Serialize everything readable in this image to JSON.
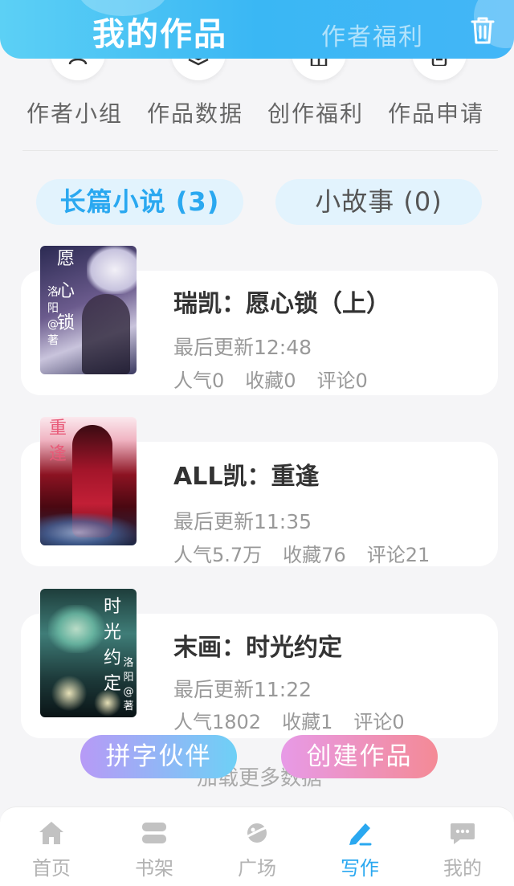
{
  "header": {
    "title": "我的作品",
    "link": "作者福利",
    "trash_icon": "trash-icon"
  },
  "menu": [
    {
      "label": "作者小组",
      "icon": "group-icon"
    },
    {
      "label": "作品数据",
      "icon": "layers-icon"
    },
    {
      "label": "创作福利",
      "icon": "gift-icon"
    },
    {
      "label": "作品申请",
      "icon": "document-icon"
    }
  ],
  "tabs": {
    "novel": "长篇小说 (3)",
    "story": "小故事 (0)"
  },
  "works": [
    {
      "title": "瑞凯：愿心锁（上）",
      "updated": "最后更新12:48",
      "popularity": "人气0",
      "favorites": "收藏0",
      "comments": "评论0",
      "cover_text": [
        "愿",
        "心",
        "锁"
      ],
      "cover_author": [
        "洛",
        "阳",
        "@",
        "著"
      ]
    },
    {
      "title": "ALL凯：重逢",
      "updated": "最后更新11:35",
      "popularity": "人气5.7万",
      "favorites": "收藏76",
      "comments": "评论21",
      "cover_text": [
        "重",
        "逢"
      ]
    },
    {
      "title": "末画：时光约定",
      "updated": "最后更新11:22",
      "popularity": "人气1802",
      "favorites": "收藏1",
      "comments": "评论0",
      "cover_text": [
        "时",
        "光",
        "约",
        "定"
      ],
      "cover_author": [
        "洛",
        "阳",
        "@",
        "著"
      ]
    }
  ],
  "load_more": "加载更多数据",
  "buttons": {
    "partner": "拼字伙伴",
    "create": "创建作品"
  },
  "nav": [
    {
      "label": "首页",
      "icon": "home-icon"
    },
    {
      "label": "书架",
      "icon": "bookshelf-icon"
    },
    {
      "label": "广场",
      "icon": "planet-icon"
    },
    {
      "label": "写作",
      "icon": "pen-icon",
      "active": true
    },
    {
      "label": "我的",
      "icon": "chat-icon"
    }
  ],
  "colors": {
    "accent": "#2aa8f0",
    "header_start": "#5cd0f5",
    "header_end": "#43b6f7",
    "create_button": "#f48a96",
    "partner_button": "#b79af6"
  }
}
